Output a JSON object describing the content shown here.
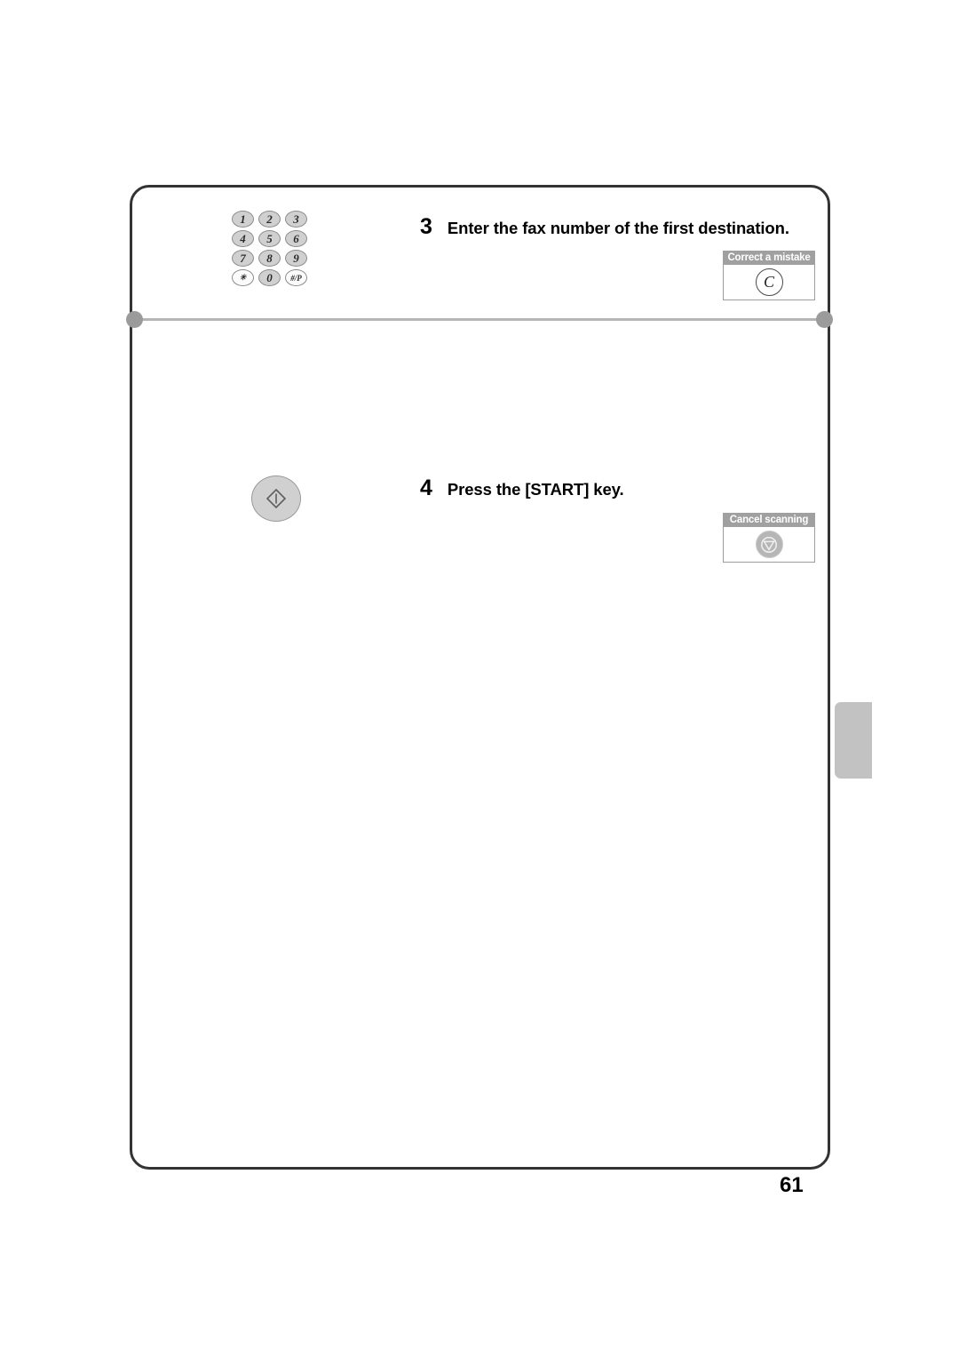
{
  "page": {
    "number": "61"
  },
  "steps": [
    {
      "number": "3",
      "text": "Enter the fax number of the first destination.",
      "illustration": "numeric-keypad",
      "callout": {
        "label": "Correct a mistake",
        "key_glyph": "C",
        "key_name": "clear-key"
      }
    },
    {
      "number": "4",
      "text": "Press the [START] key.",
      "illustration": "start-key",
      "callout": {
        "label": "Cancel scanning",
        "key_glyph": "stop",
        "key_name": "stop-key"
      }
    }
  ],
  "keypad": {
    "rows": [
      [
        {
          "label": "1",
          "style": "filled"
        },
        {
          "label": "2",
          "style": "filled"
        },
        {
          "label": "3",
          "style": "filled"
        }
      ],
      [
        {
          "label": "4",
          "style": "filled"
        },
        {
          "label": "5",
          "style": "filled"
        },
        {
          "label": "6",
          "style": "filled"
        }
      ],
      [
        {
          "label": "7",
          "style": "filled"
        },
        {
          "label": "8",
          "style": "filled"
        },
        {
          "label": "9",
          "style": "filled"
        }
      ],
      [
        {
          "label": "✳",
          "style": "light",
          "size": "small"
        },
        {
          "label": "0",
          "style": "filled"
        },
        {
          "label": "#/P",
          "style": "light",
          "size": "small"
        }
      ]
    ]
  },
  "colors": {
    "frame_border": "#333333",
    "divider": "#b5b5b5",
    "divider_dot": "#9b9b9b",
    "callout_label_bg": "#a0a0a0",
    "key_fill": "#d0d0d0",
    "chapter_tab": "#c2c2c2"
  }
}
